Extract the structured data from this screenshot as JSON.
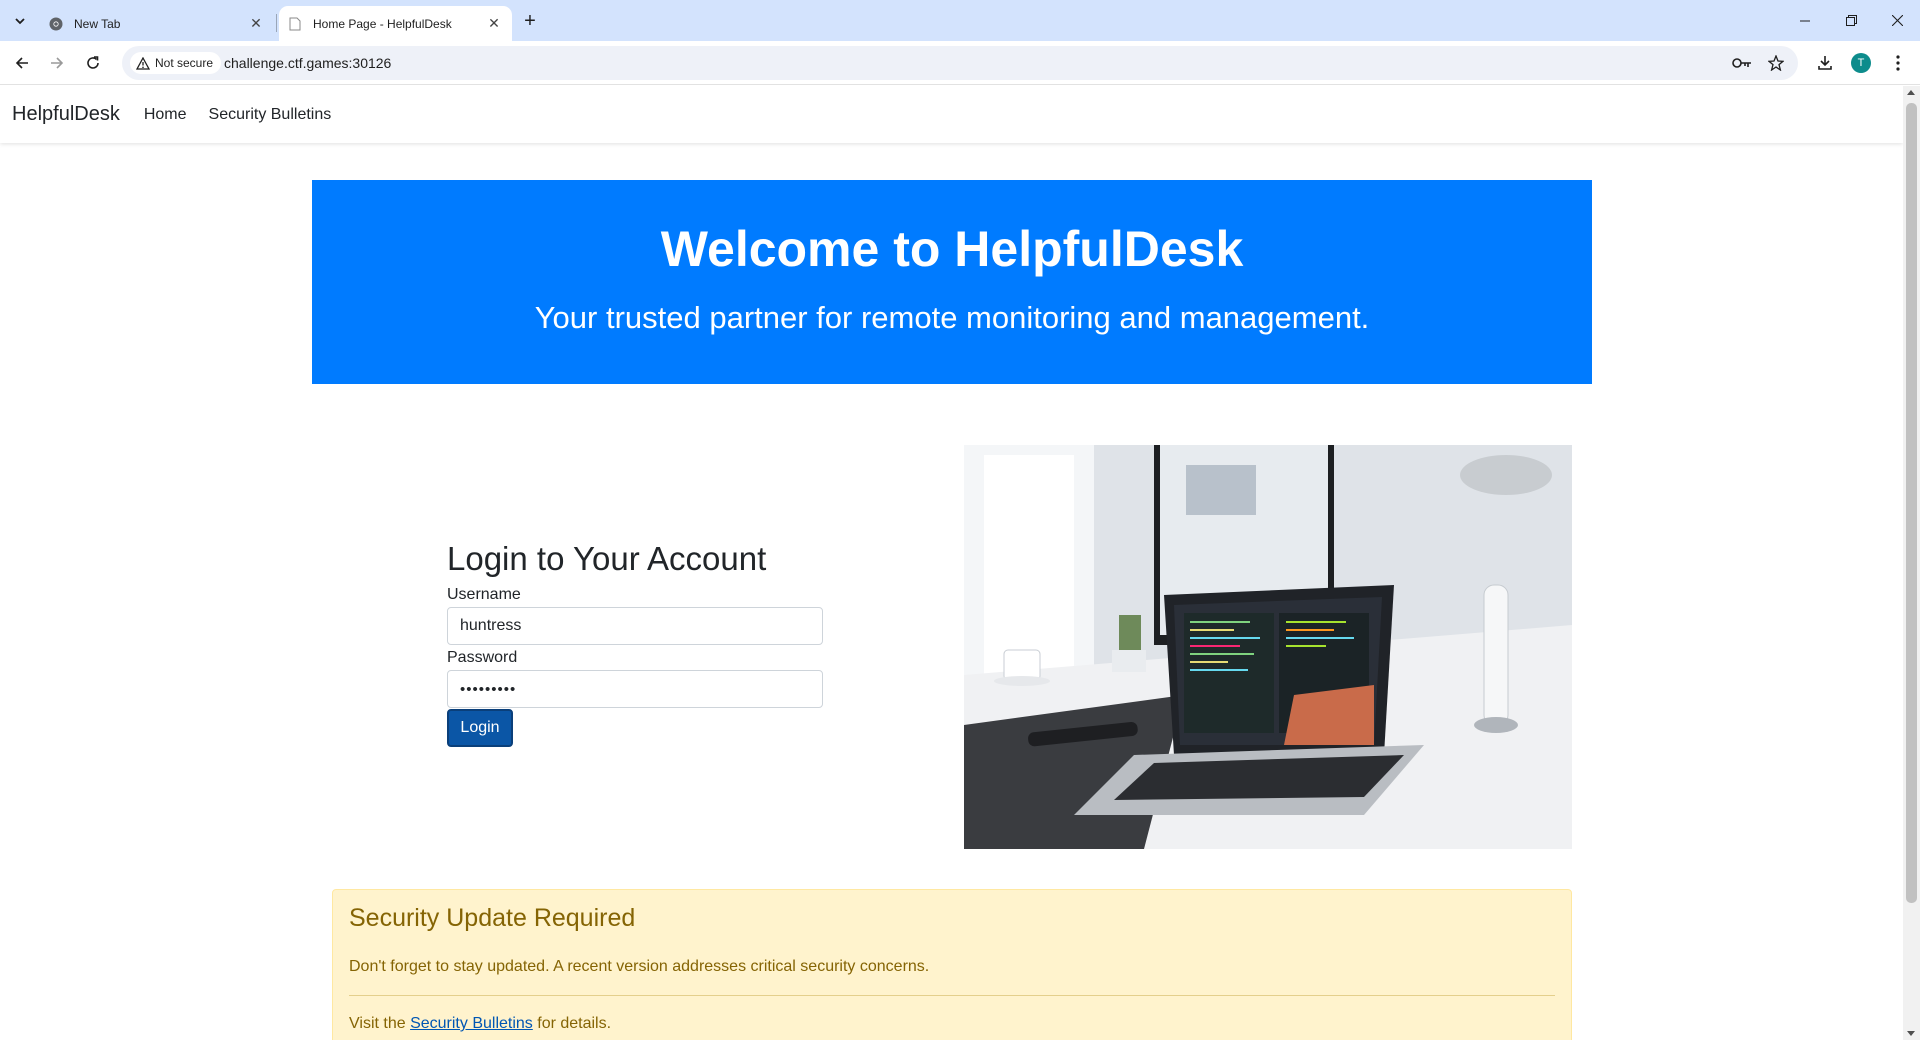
{
  "browser": {
    "tabs": [
      {
        "title": "New Tab",
        "favicon": "chrome-icon",
        "active": false
      },
      {
        "title": "Home Page - HelpfulDesk",
        "favicon": "page-icon",
        "active": true
      }
    ],
    "security_label": "Not secure",
    "url": "challenge.ctf.games:30126",
    "profile_initial": "T"
  },
  "site": {
    "brand": "HelpfulDesk",
    "nav": [
      "Home",
      "Security Bulletins"
    ]
  },
  "hero": {
    "title": "Welcome to HelpfulDesk",
    "subtitle": "Your trusted partner for remote monitoring and management."
  },
  "login": {
    "heading": "Login to Your Account",
    "username_label": "Username",
    "username_value": "huntress",
    "password_label": "Password",
    "password_value": "•••••••••",
    "button": "Login"
  },
  "alert": {
    "title": "Security Update Required",
    "message": "Don't forget to stay updated. A recent version addresses critical security concerns.",
    "visit_prefix": "Visit the ",
    "link": "Security Bulletins",
    "visit_suffix": " for details."
  },
  "colors": {
    "hero_bg": "#007bff",
    "login_button": "#0b56a6",
    "alert_bg": "#fff3cd",
    "alert_text": "#856404"
  }
}
